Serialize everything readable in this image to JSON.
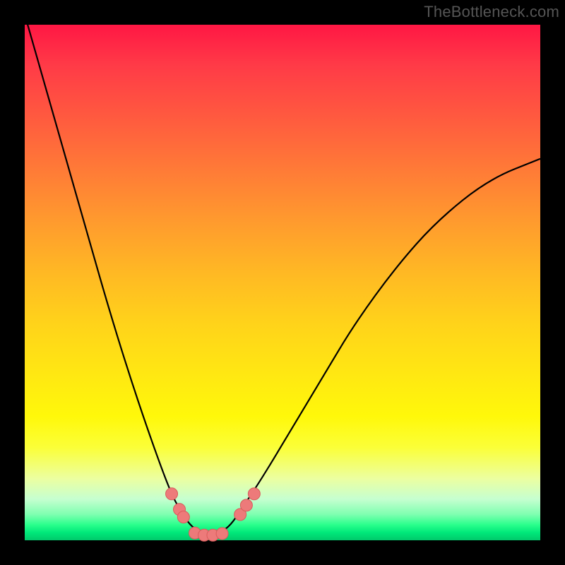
{
  "watermark": "TheBottleneck.com",
  "chart_data": {
    "type": "line",
    "title": "",
    "xlabel": "",
    "ylabel": "",
    "xlim": [
      0,
      1
    ],
    "ylim": [
      0,
      1
    ],
    "series": [
      {
        "name": "curve",
        "x": [
          0.0,
          0.04,
          0.08,
          0.12,
          0.16,
          0.2,
          0.24,
          0.28,
          0.3,
          0.32,
          0.34,
          0.36,
          0.38,
          0.4,
          0.42,
          0.46,
          0.52,
          0.58,
          0.64,
          0.72,
          0.8,
          0.9,
          1.0
        ],
        "y": [
          1.02,
          0.88,
          0.74,
          0.6,
          0.46,
          0.33,
          0.21,
          0.1,
          0.06,
          0.03,
          0.015,
          0.01,
          0.015,
          0.03,
          0.06,
          0.12,
          0.22,
          0.32,
          0.42,
          0.53,
          0.62,
          0.7,
          0.74
        ]
      }
    ],
    "markers": [
      {
        "x": 0.285,
        "y": 0.09
      },
      {
        "x": 0.3,
        "y": 0.06
      },
      {
        "x": 0.308,
        "y": 0.045
      },
      {
        "x": 0.33,
        "y": 0.014
      },
      {
        "x": 0.348,
        "y": 0.01
      },
      {
        "x": 0.365,
        "y": 0.01
      },
      {
        "x": 0.383,
        "y": 0.013
      },
      {
        "x": 0.418,
        "y": 0.05
      },
      {
        "x": 0.43,
        "y": 0.068
      },
      {
        "x": 0.445,
        "y": 0.09
      }
    ],
    "colors": {
      "curve": "#000000",
      "marker_fill": "#ed7a7a",
      "marker_stroke": "#d95b5b"
    }
  }
}
